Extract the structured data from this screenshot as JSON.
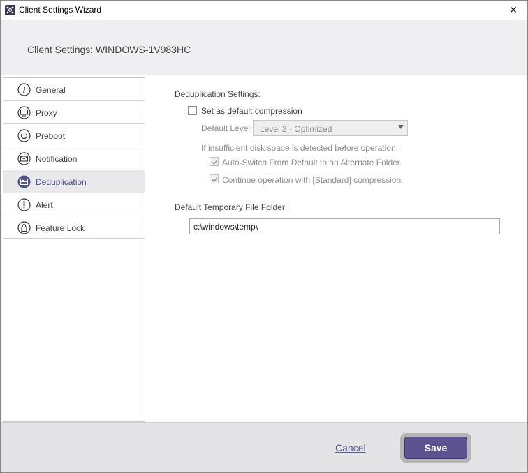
{
  "window": {
    "title": "Client Settings Wizard",
    "close_symbol": "✕"
  },
  "header": {
    "title": "Client Settings: WINDOWS-1V983HC"
  },
  "sidebar": {
    "items": [
      {
        "label": "General",
        "icon": "info-icon"
      },
      {
        "label": "Proxy",
        "icon": "monitor-icon"
      },
      {
        "label": "Preboot",
        "icon": "power-icon"
      },
      {
        "label": "Notification",
        "icon": "envelope-icon"
      },
      {
        "label": "Deduplication",
        "icon": "deduplication-icon",
        "active": true
      },
      {
        "label": "Alert",
        "icon": "exclamation-icon"
      },
      {
        "label": "Feature Lock",
        "icon": "lock-icon"
      }
    ]
  },
  "dedup": {
    "section_label": "Deduplication Settings:",
    "default_compression": {
      "label": "Set as default compression",
      "checked": false
    },
    "default_level": {
      "label": "Default Level:",
      "value": "Level 2 - Optimized"
    },
    "insufficient_label": "If insufficient disk space is detected before operation:",
    "auto_switch": {
      "label": "Auto-Switch From Default to an Alternate Folder.",
      "checked": true,
      "disabled": true
    },
    "continue_standard": {
      "label": "Continue operation with [Standard] compression.",
      "checked": true,
      "disabled": true
    },
    "temp_folder_label": "Default Temporary File Folder:",
    "temp_folder_value": "c:\\windows\\temp\\"
  },
  "footer": {
    "cancel_label": "Cancel",
    "save_label": "Save"
  },
  "colors": {
    "accent": "#5c5390",
    "active_nav_bg": "#e9e9ec",
    "header_bg": "#efeff1",
    "footer_bg": "#e4e4e6"
  }
}
